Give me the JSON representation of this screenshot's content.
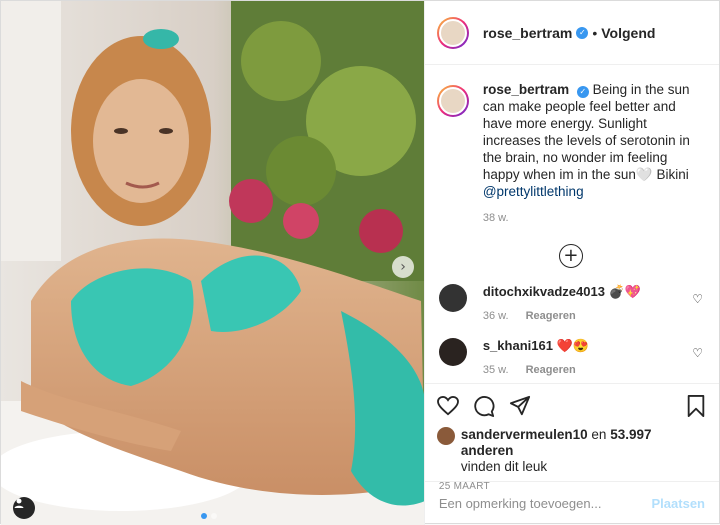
{
  "post": {
    "author": "rose_bertram",
    "follow_sep": "•",
    "follow_status": "Volgend",
    "caption": "Being in the sun can make people feel better and have more energy. Sunlight increases the levels of serotonin in the brain, no wonder im feeling happy when im in the sun🤍 Bikini",
    "caption_tag": "@prettylittlething",
    "caption_time": "38 w.",
    "photo_alt": "Photo of a woman in a turquoise bikini lying on a white cushion"
  },
  "comments": [
    {
      "user": "ditochxikvadze4013",
      "text": "💣💖",
      "time": "36 w.",
      "reply": "Reageren"
    },
    {
      "user": "s_khani161",
      "text": "❤️😍",
      "time": "35 w.",
      "reply": "Reageren"
    }
  ],
  "likes": {
    "user": "sandervermeulen10",
    "mid": "en",
    "count": "53.997 anderen",
    "suffix": "vinden dit leuk"
  },
  "date": "25 MAART",
  "add_comment": {
    "placeholder": "Een opmerking toevoegen...",
    "post_label": "Plaatsen"
  },
  "icons": {
    "next": "chevron-right-icon",
    "verified": "verified-badge-icon",
    "user_tag": "user-tag-icon"
  }
}
